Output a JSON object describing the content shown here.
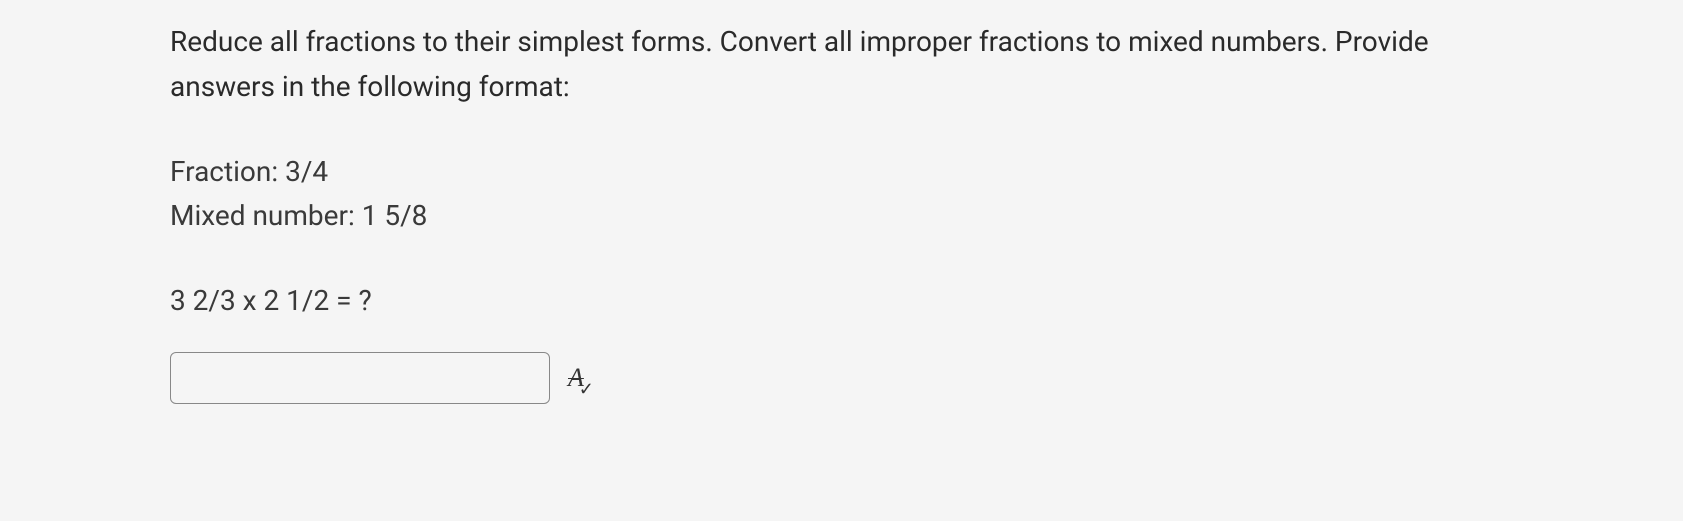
{
  "instruction": "Reduce all fractions to their simplest forms. Convert all improper fractions to mixed numbers. Provide answers in the following format:",
  "examples": {
    "fraction": "Fraction: 3/4",
    "mixed": "Mixed number: 1 5/8"
  },
  "question": "3 2/3 x 2 1/2 = ?",
  "answer_value": "",
  "spellcheck_letter": "A",
  "spellcheck_check": "✓"
}
